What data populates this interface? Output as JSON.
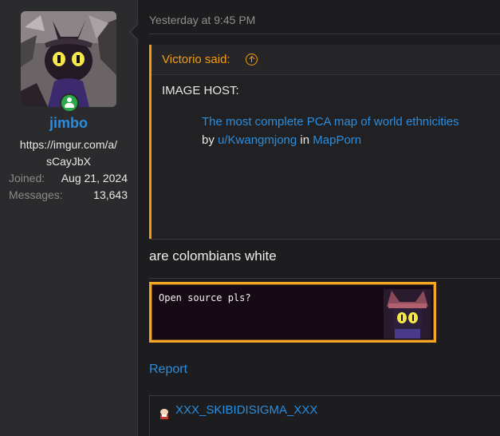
{
  "user": {
    "name": "jimbo",
    "title_line1": "https://imgur.com/a/",
    "title_line2": "sCayJbX",
    "joined_label": "Joined:",
    "joined_value": "Aug 21, 2024",
    "messages_label": "Messages:",
    "messages_value": "13,643"
  },
  "post": {
    "timestamp": "Yesterday at 9:45 PM",
    "quote": {
      "author": "Victorio said:",
      "text": "IMAGE HOST:",
      "embed_title": "The most complete PCA map of world ethnicities",
      "embed_by": "by",
      "embed_user": "u/Kwangmjong",
      "embed_in": "in",
      "embed_sub": "MapPorn"
    },
    "body": "are colombians white",
    "dialog_text": "Open source pls?",
    "report": "Report",
    "signature": "XXX_SKIBIDISIGMA_XXX"
  },
  "colors": {
    "link": "#2b8ddf",
    "quote_accent": "#f39c12",
    "online": "#2aa84a"
  }
}
